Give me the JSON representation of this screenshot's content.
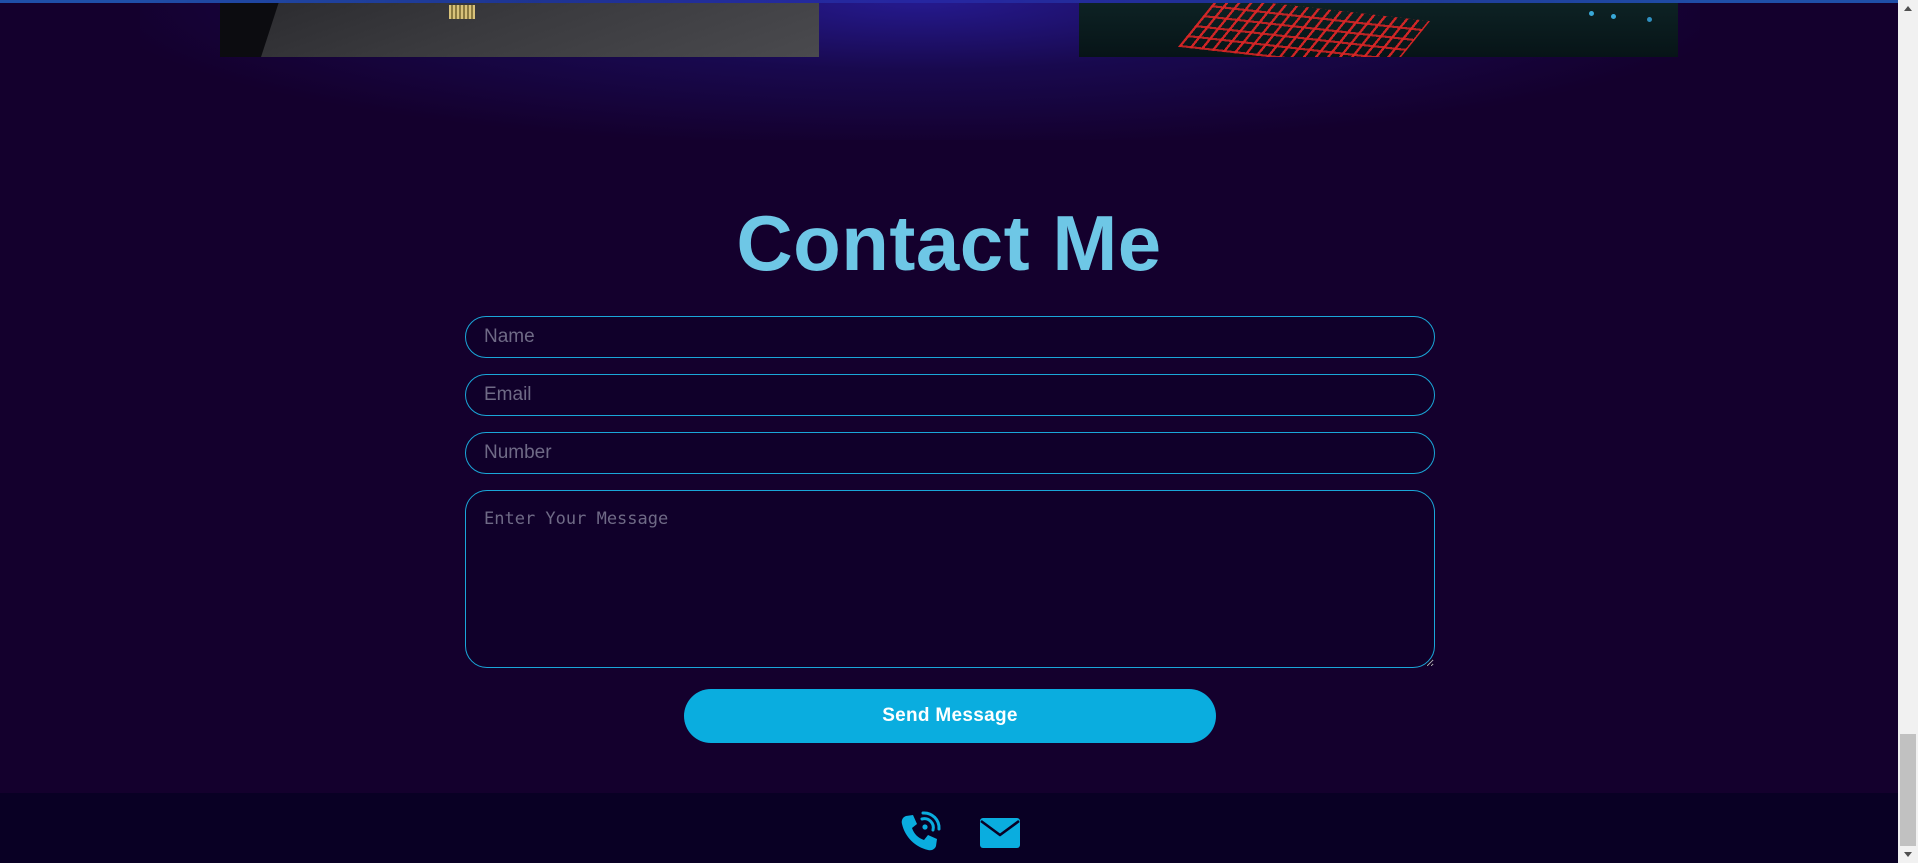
{
  "section": {
    "title": "Contact Me"
  },
  "form": {
    "name_placeholder": "Name",
    "email_placeholder": "Email",
    "number_placeholder": "Number",
    "message_placeholder": "Enter Your Message",
    "submit_label": "Send Message"
  },
  "footer": {
    "icons": [
      "phone-icon",
      "mail-icon"
    ]
  },
  "colors": {
    "background": "#14002d",
    "title": "#6ec7e6",
    "accent": "#0aaddf",
    "field_border": "#1aa6d8",
    "footer": "#090024"
  }
}
